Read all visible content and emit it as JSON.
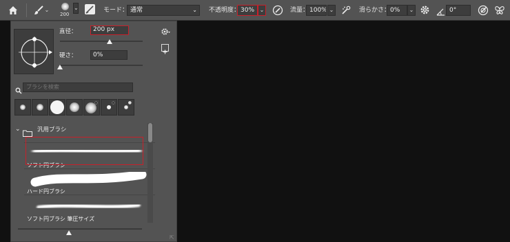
{
  "options_bar": {
    "brush_size": "200",
    "mode_label": "モード：",
    "mode_value": "通常",
    "opacity_label": "不透明度：",
    "opacity_value": "30%",
    "flow_label": "流量：",
    "flow_value": "100%",
    "smoothing_label": "滑らかさ：",
    "smoothing_value": "0%",
    "angle_value": "0°"
  },
  "brush_panel": {
    "size_label": "直径：",
    "size_value": "200 px",
    "hardness_label": "硬さ：",
    "hardness_value": "0%",
    "search_placeholder": "ブラシを検索",
    "group_name": "汎用ブラシ",
    "brushes": [
      "ソフト円ブラシ",
      "ハード円ブラシ",
      "ソフト円ブラシ 筆圧サイズ"
    ]
  },
  "colors": {
    "accent_highlight": "#c8202a",
    "panel_background": "#535353",
    "canvas_background": "#111111"
  }
}
